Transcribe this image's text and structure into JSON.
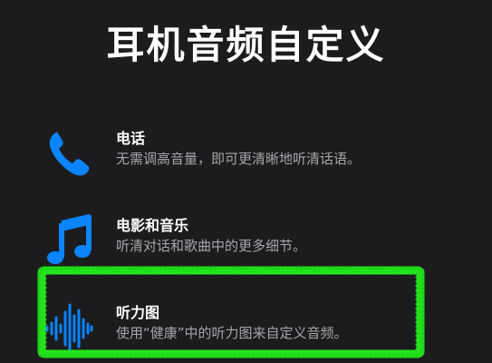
{
  "page": {
    "title": "耳机音频自定义"
  },
  "options": [
    {
      "label": "电话",
      "description": "无需调高音量，即可更清晰地听清话语。",
      "icon": "phone-icon"
    },
    {
      "label": "电影和音乐",
      "description": "听清对话和歌曲中的更多细节。",
      "icon": "music-note-icon"
    },
    {
      "label": "听力图",
      "description": "使用“健康”中的听力图来自定义音频。",
      "icon": "waveform-icon"
    }
  ],
  "colors": {
    "background": "#1c1c1e",
    "accent": "#0a84ff",
    "secondary_text": "#a6a6ab",
    "highlight": "#22e01a"
  }
}
